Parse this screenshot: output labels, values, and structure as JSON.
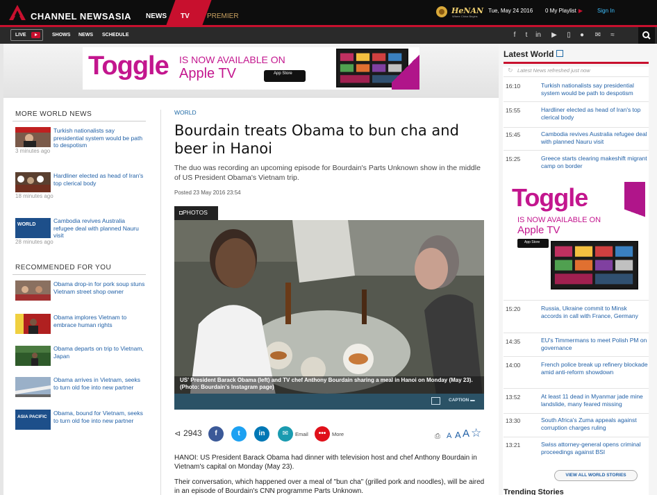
{
  "header": {
    "brand": "CHANNEL NEWSASIA",
    "nav": [
      "NEWS",
      "TV",
      "PREMIER"
    ],
    "sponsor_logo": "HeNAN",
    "sponsor_tagline": "Where China Begins",
    "date": "Tue, May 24 2016",
    "playlist": "0 My Playlist",
    "signin": "Sign In",
    "brand_color": "#c8102e"
  },
  "subnav": {
    "live": "LIVE",
    "links": [
      "SHOWS",
      "NEWS",
      "SCHEDULE"
    ],
    "social_icons": [
      "facebook-icon",
      "twitter-icon",
      "linkedin-icon",
      "youtube-icon",
      "mobile-icon",
      "chat-icon",
      "email-icon",
      "rss-icon"
    ]
  },
  "banner": {
    "logo": "Toggle",
    "line1": "IS NOW AVAILABLE ON",
    "line2": "Apple TV",
    "badge": "App Store",
    "color": "#c3168e"
  },
  "left": {
    "more_title": "MORE WORLD NEWS",
    "more": [
      {
        "title": "Turkish nationalists say presidential system would be path to despotism",
        "time": "3 minutes ago"
      },
      {
        "title": "Hardliner elected as head of Iran's top clerical body",
        "time": "18 minutes ago"
      },
      {
        "title": "Cambodia revives Australia refugee deal with planned Nauru visit",
        "time": "28 minutes ago"
      }
    ],
    "rec_title": "RECOMMENDED FOR YOU",
    "rec": [
      {
        "title": "Obama drop-in for pork soup stuns Vietnam street shop owner"
      },
      {
        "title": "Obama implores Vietnam to embrace human rights"
      },
      {
        "title": "Obama departs on trip to Vietnam, Japan"
      },
      {
        "title": "Obama arrives in Vietnam, seeks to turn old foe into new partner"
      },
      {
        "title": "Obama, bound for Vietnam, seeks to turn old foe into new partner"
      }
    ],
    "thumb_labels": {
      "world": "WORLD",
      "asia": "ASIA PACIFIC"
    }
  },
  "article": {
    "category": "WORLD",
    "headline": "Bourdain treats Obama to bun cha and beer in Hanoi",
    "standfirst": "The duo was recording an upcoming episode for Bourdain's Parts Unknown show in the middle of US President Obama's Vietnam trip.",
    "posted": "Posted 23 May 2016 23:54",
    "photos_label": "PHOTOS",
    "caption": "US' President Barack Obama (left) and TV chef Anthony Bourdain sharing a meal in Hanoi on Monday (May 23). (Photo: Bourdain's Instagram page)",
    "caption_button": "CAPTION",
    "share_count": "2943",
    "share_email": "Email",
    "share_more": "More",
    "font_sizes": [
      "A",
      "A",
      "A"
    ],
    "para1": "HANOI: US President Barack Obama had dinner with television host and chef Anthony Bourdain in Vietnam's capital on Monday (May 23).",
    "para2": "Their conversation, which happened over a meal of \"bun cha\" (grilled pork and noodles), will be aired in an episode of Bourdain's CNN programme Parts Unknown."
  },
  "right": {
    "title": "Latest World",
    "refresh_note": "Latest News refreshed just now",
    "items_top": [
      {
        "time": "16:10",
        "title": "Turkish nationalists say presidential system would be path to despotism"
      },
      {
        "time": "15:55",
        "title": "Hardliner elected as head of Iran's top clerical body"
      },
      {
        "time": "15:45",
        "title": "Cambodia revives Australia refugee deal with planned Nauru visit"
      },
      {
        "time": "15:25",
        "title": "Greece starts clearing makeshift migrant camp on border"
      }
    ],
    "items_bottom": [
      {
        "time": "15:20",
        "title": "Russia, Ukraine commit to Minsk accords in call with France, Germany"
      },
      {
        "time": "14:35",
        "title": "EU's Timmermans to meet Polish PM on governance"
      },
      {
        "time": "14:00",
        "title": "French police break up refinery blockade amid anti-reform showdown"
      },
      {
        "time": "13:52",
        "title": "At least 11 dead in Myanmar jade mine landslide, many feared missing"
      },
      {
        "time": "13:30",
        "title": "South Africa's Zuma appeals against corruption charges ruling"
      },
      {
        "time": "13:21",
        "title": "Swiss attorney-general opens criminal proceedings against BSI"
      }
    ],
    "view_all": "VIEW ALL WORLD STORIES",
    "trending": "Trending Stories"
  }
}
